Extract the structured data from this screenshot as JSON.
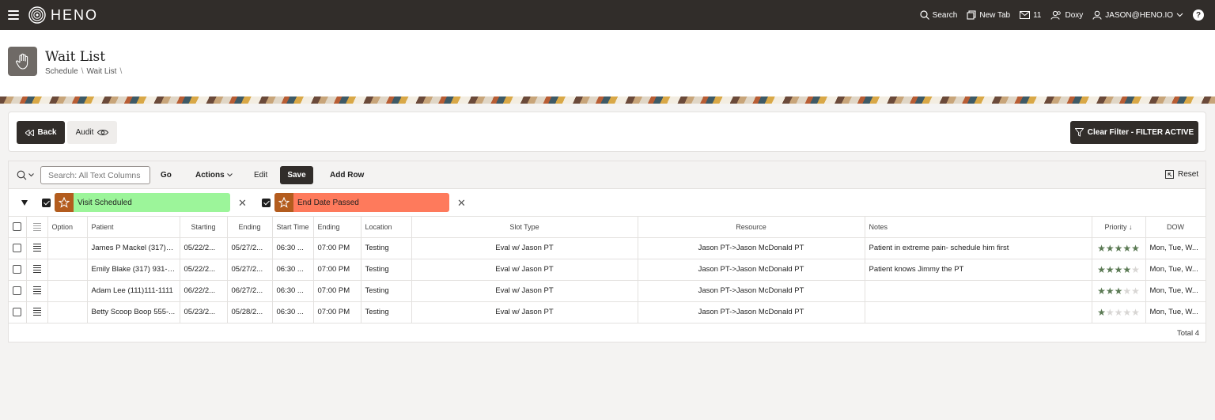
{
  "app": {
    "brand": "HENO",
    "nav": {
      "search": "Search",
      "new_tab": "New Tab",
      "mail_count": "11",
      "doxy": "Doxy",
      "user": "JASON@HENO.IO",
      "help": "?"
    }
  },
  "page": {
    "title": "Wait List",
    "breadcrumb": [
      "Schedule",
      "Wait List"
    ],
    "breadcrumb_sep": "\\"
  },
  "actions": {
    "back": "Back",
    "audit": "Audit",
    "clear_filter": "Clear Filter - FILTER ACTIVE"
  },
  "toolbar": {
    "search_placeholder": "Search: All Text Columns",
    "go": "Go",
    "actions": "Actions",
    "edit": "Edit",
    "save": "Save",
    "add_row": "Add Row",
    "reset": "Reset"
  },
  "filters": [
    {
      "label": "Visit Scheduled",
      "color": "#9cf59a",
      "checked": true
    },
    {
      "label": "End Date Passed",
      "color": "#fe7a5c",
      "checked": true
    }
  ],
  "columns": [
    "Option",
    "Patient",
    "Starting",
    "Ending",
    "Start Time",
    "Ending",
    "Location",
    "Slot Type",
    "Resource",
    "Notes",
    "Priority",
    "DOW"
  ],
  "rows": [
    {
      "patient": "James P Mackel (317)9...",
      "starting": "05/22/2...",
      "ending": "05/27/2...",
      "start_time": "06:30 ...",
      "end_time": "07:00 PM",
      "location": "Testing",
      "slot_type": "Eval w/ Jason PT",
      "resource": "Jason PT->Jason McDonald PT",
      "notes": "Patient in extreme pain- schedule him first",
      "priority": 5,
      "dow": "Mon, Tue, W..."
    },
    {
      "patient": "Emily Blake (317) 931-9...",
      "starting": "05/22/2...",
      "ending": "05/27/2...",
      "start_time": "06:30 ...",
      "end_time": "07:00 PM",
      "location": "Testing",
      "slot_type": "Eval w/ Jason PT",
      "resource": "Jason PT->Jason McDonald PT",
      "notes": "Patient knows Jimmy the PT",
      "priority": 4,
      "dow": "Mon, Tue, W..."
    },
    {
      "patient": "Adam Lee (111)111-1111",
      "starting": "06/22/2...",
      "ending": "06/27/2...",
      "start_time": "06:30 ...",
      "end_time": "07:00 PM",
      "location": "Testing",
      "slot_type": "Eval w/ Jason PT",
      "resource": "Jason PT->Jason McDonald PT",
      "notes": "",
      "priority": 3,
      "dow": "Mon, Tue, W..."
    },
    {
      "patient": "Betty Scoop Boop 555-...",
      "starting": "05/23/2...",
      "ending": "05/28/2...",
      "start_time": "06:30 ...",
      "end_time": "07:00 PM",
      "location": "Testing",
      "slot_type": "Eval w/ Jason PT",
      "resource": "Jason PT->Jason McDonald PT",
      "notes": "",
      "priority": 1,
      "dow": "Mon, Tue, W..."
    }
  ],
  "total": "Total 4"
}
